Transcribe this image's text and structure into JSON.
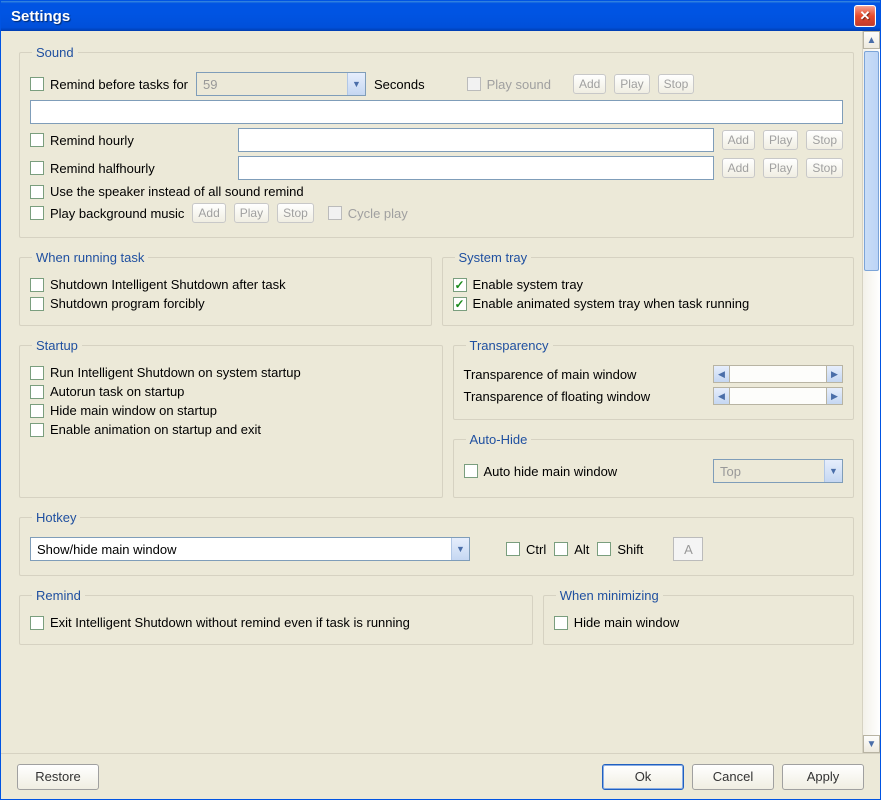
{
  "title": "Settings",
  "sound": {
    "legend": "Sound",
    "remind_before": "Remind before tasks for",
    "seconds_value": "59",
    "seconds_label": "Seconds",
    "play_sound": "Play sound",
    "remind_hourly": "Remind hourly",
    "remind_halfhourly": "Remind halfhourly",
    "speaker": "Use the speaker instead of all sound remind",
    "bg_music": "Play background music",
    "cycle_play": "Cycle play",
    "add": "Add",
    "play": "Play",
    "stop": "Stop"
  },
  "running": {
    "legend": "When running task",
    "shutdown_after": "Shutdown Intelligent Shutdown after task",
    "shutdown_forcibly": "Shutdown program forcibly"
  },
  "systray": {
    "legend": "System tray",
    "enable": "Enable system tray",
    "animated": "Enable animated system tray when task running"
  },
  "startup": {
    "legend": "Startup",
    "run": "Run Intelligent Shutdown on system startup",
    "autorun": "Autorun task on startup",
    "hide": "Hide main window on startup",
    "anim": "Enable animation on startup and exit"
  },
  "transparency": {
    "legend": "Transparency",
    "main": "Transparence of main window",
    "float": "Transparence of floating window"
  },
  "autohide": {
    "legend": "Auto-Hide",
    "auto": "Auto hide main window",
    "pos": "Top"
  },
  "hotkey": {
    "legend": "Hotkey",
    "action": "Show/hide main window",
    "ctrl": "Ctrl",
    "alt": "Alt",
    "shift": "Shift",
    "key": "A"
  },
  "remind": {
    "legend": "Remind",
    "exit": "Exit Intelligent Shutdown without remind even if task is running"
  },
  "minimizing": {
    "legend": "When minimizing",
    "hide": "Hide main window"
  },
  "footer": {
    "restore": "Restore",
    "ok": "Ok",
    "cancel": "Cancel",
    "apply": "Apply"
  }
}
